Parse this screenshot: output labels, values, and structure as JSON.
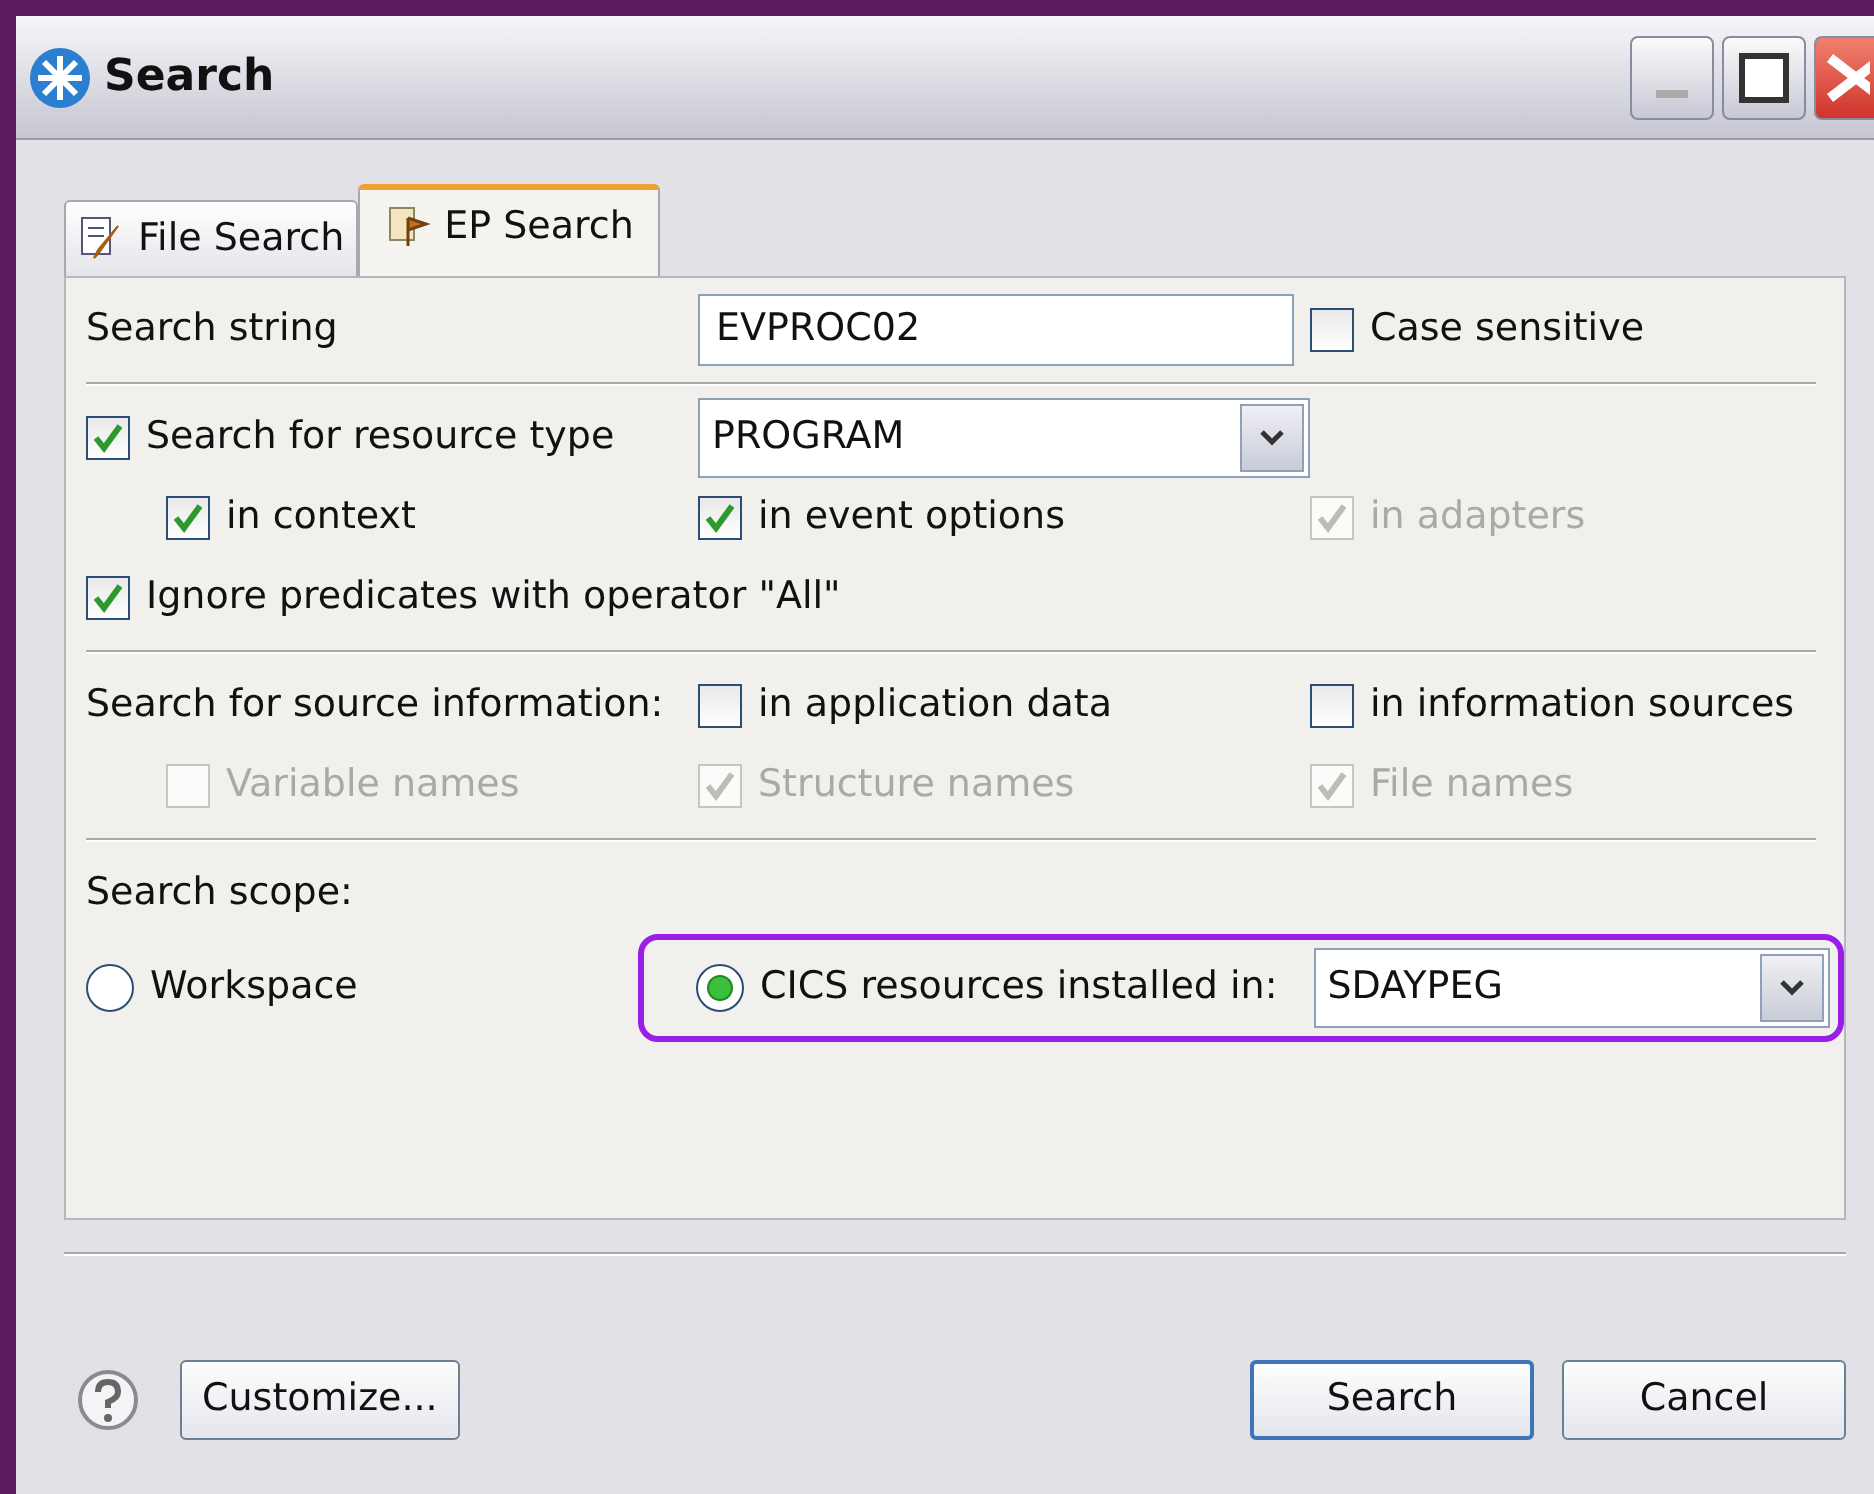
{
  "window": {
    "title": "Search"
  },
  "tabs": [
    {
      "label": "File Search",
      "selected": false
    },
    {
      "label": "EP Search",
      "selected": true
    }
  ],
  "search_string": {
    "label": "Search string",
    "value": "EVPROC02",
    "case_sensitive": {
      "label": "Case sensitive",
      "checked": false
    }
  },
  "resource_type": {
    "label": "Search for resource type",
    "checked": true,
    "value": "PROGRAM",
    "options": [
      {
        "label": "in context",
        "checked": true,
        "disabled": false
      },
      {
        "label": "in event options",
        "checked": true,
        "disabled": false
      },
      {
        "label": "in adapters",
        "checked": true,
        "disabled": true
      }
    ]
  },
  "ignore_predicates": {
    "label": "Ignore predicates with operator \"All\"",
    "checked": true
  },
  "source_information": {
    "label": "Search for source information:",
    "options": [
      {
        "label": "in application data",
        "checked": false,
        "disabled": false
      },
      {
        "label": "in information sources",
        "checked": false,
        "disabled": false
      }
    ],
    "sub_options": [
      {
        "label": "Variable names",
        "checked": false,
        "disabled": true
      },
      {
        "label": "Structure names",
        "checked": true,
        "disabled": true
      },
      {
        "label": "File names",
        "checked": true,
        "disabled": true
      }
    ]
  },
  "search_scope": {
    "label": "Search scope:",
    "highlighted": true,
    "value": "SDAYPEG",
    "options": [
      {
        "label": "Workspace",
        "selected": false
      },
      {
        "label": "CICS resources installed in:",
        "selected": true
      }
    ]
  },
  "buttons": [
    {
      "label": "Customize...",
      "default": false
    },
    {
      "label": "Search",
      "default": true
    },
    {
      "label": "Cancel",
      "default": false
    }
  ]
}
